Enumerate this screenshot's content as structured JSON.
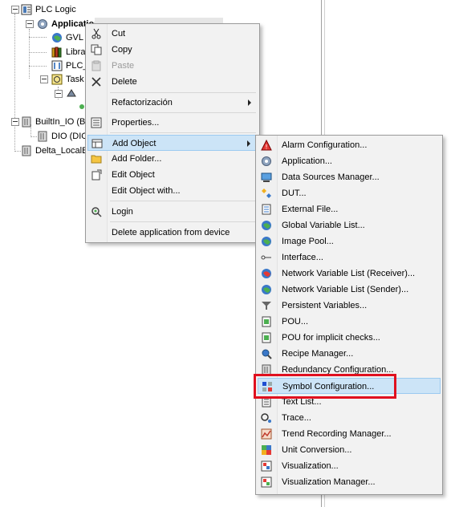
{
  "tree": {
    "root": "PLC Logic",
    "application": "Application",
    "gvl": "GVL",
    "library": "Librar",
    "plc_prg": "PLC_",
    "task": "Task",
    "builtin": "BuiltIn_IO (Bu",
    "dio": "DIO (DIO",
    "delta": "Delta_LocalBu"
  },
  "context_menu": {
    "items": [
      {
        "label": "Cut",
        "icon": "scissors-icon"
      },
      {
        "label": "Copy",
        "icon": "copy-icon"
      },
      {
        "label": "Paste",
        "icon": "paste-icon",
        "disabled": true
      },
      {
        "label": "Delete",
        "icon": "delete-x-icon"
      },
      {
        "label": "Refactorización",
        "submenu": true
      },
      {
        "label": "Properties...",
        "icon": "properties-icon"
      },
      {
        "label": "Add Object",
        "icon": "add-object-icon",
        "submenu": true,
        "highlighted": true
      },
      {
        "label": "Add Folder...",
        "icon": "folder-icon"
      },
      {
        "label": "Edit Object",
        "icon": "edit-object-icon"
      },
      {
        "label": "Edit Object with..."
      },
      {
        "label": "Login",
        "icon": "login-icon"
      },
      {
        "label": "Delete application from device"
      }
    ]
  },
  "submenu": {
    "items": [
      {
        "label": "Alarm Configuration...",
        "icon": "alarm-icon"
      },
      {
        "label": "Application...",
        "icon": "application-gear-icon"
      },
      {
        "label": "Data Sources Manager...",
        "icon": "data-sources-icon"
      },
      {
        "label": "DUT...",
        "icon": "dut-icon"
      },
      {
        "label": "External File...",
        "icon": "external-file-icon"
      },
      {
        "label": "Global Variable List...",
        "icon": "globe-icon"
      },
      {
        "label": "Image Pool...",
        "icon": "image-pool-icon"
      },
      {
        "label": "Interface...",
        "icon": "interface-icon"
      },
      {
        "label": "Network Variable List (Receiver)...",
        "icon": "network-globe-icon"
      },
      {
        "label": "Network Variable List (Sender)...",
        "icon": "network-globe-icon"
      },
      {
        "label": "Persistent Variables...",
        "icon": "persistent-icon"
      },
      {
        "label": "POU...",
        "icon": "pou-icon"
      },
      {
        "label": "POU for implicit checks...",
        "icon": "pou-checks-icon"
      },
      {
        "label": "Recipe Manager...",
        "icon": "recipe-icon"
      },
      {
        "label": "Redundancy Configuration...",
        "icon": "redundancy-icon"
      },
      {
        "label": "Symbol Configuration...",
        "icon": "symbol-config-icon",
        "highlighted": true
      },
      {
        "label": "Text List...",
        "icon": "text-list-icon"
      },
      {
        "label": "Trace...",
        "icon": "trace-icon"
      },
      {
        "label": "Trend Recording Manager...",
        "icon": "trend-icon"
      },
      {
        "label": "Unit Conversion...",
        "icon": "unit-conversion-icon"
      },
      {
        "label": "Visualization...",
        "icon": "visualization-icon"
      },
      {
        "label": "Visualization Manager...",
        "icon": "visualization-manager-icon"
      }
    ]
  },
  "colors": {
    "highlight": "#cce4f7",
    "highlight_border": "#9ccaf0",
    "red_annotation": "#e0101f"
  }
}
